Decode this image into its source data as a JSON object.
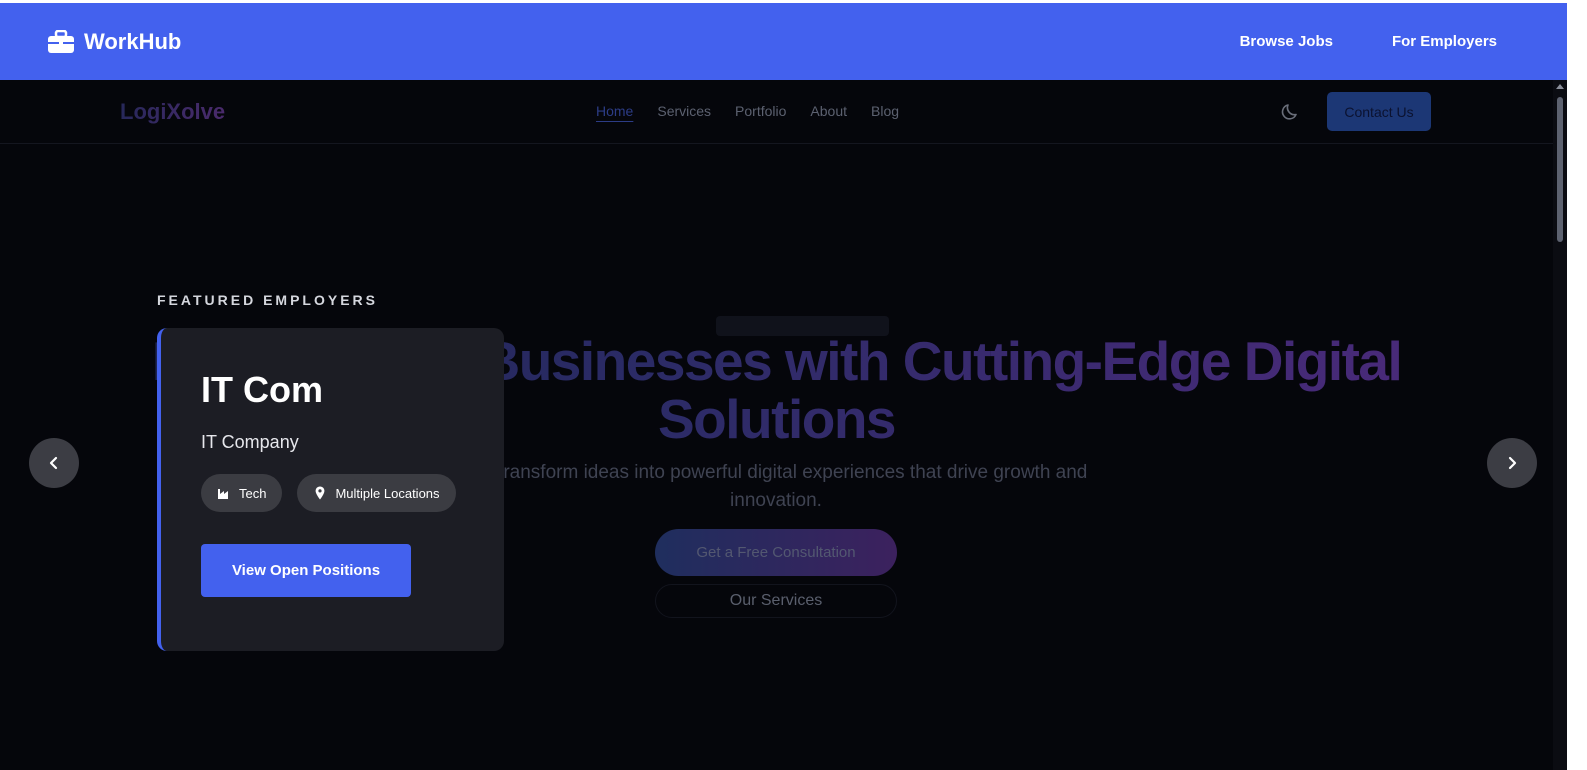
{
  "workhub": {
    "brand": "WorkHub",
    "nav": [
      "Browse Jobs",
      "For Employers"
    ],
    "accent": "#4361ee"
  },
  "site": {
    "logo": "LogiXolve",
    "links": [
      "Home",
      "Services",
      "Portfolio",
      "About",
      "Blog"
    ],
    "active_link": "Home",
    "contact_label": "Contact Us",
    "hero_title": "Empowering Businesses with Cutting-Edge Digital Solutions",
    "hero_subtitle": "We transform ideas into powerful digital experiences that drive growth and innovation.",
    "cta_primary": "Get a Free Consultation",
    "cta_secondary": "Our Services"
  },
  "featured": {
    "label": "FEATURED EMPLOYERS",
    "employer": {
      "name": "IT Com",
      "type": "IT Company",
      "industry_tag": "Tech",
      "location_tag": "Multiple Locations",
      "button_label": "View Open Positions"
    },
    "icons": {
      "brand": "briefcase-icon",
      "industry": "industry-icon",
      "location": "map-pin-icon",
      "prev": "chevron-left-icon",
      "next": "chevron-right-icon",
      "theme": "moon-icon"
    }
  }
}
